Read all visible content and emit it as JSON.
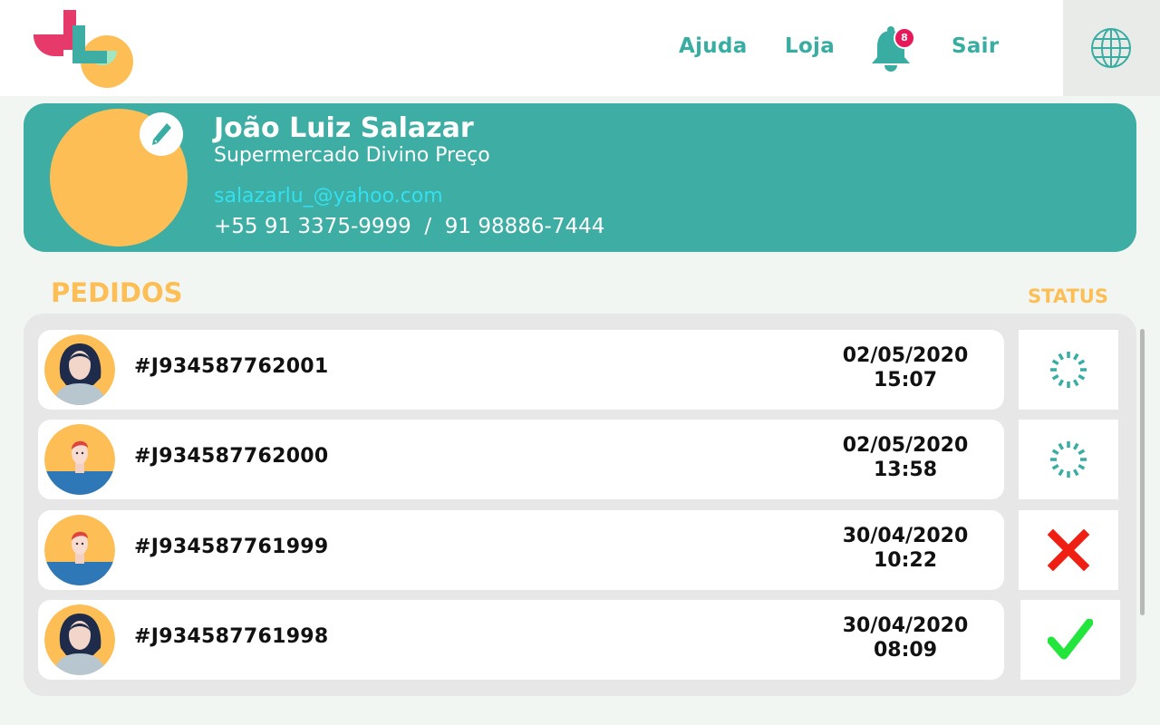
{
  "header": {
    "nav": {
      "help": "Ajuda",
      "store": "Loja",
      "logout": "Sair"
    },
    "notifications": {
      "count": "8",
      "icon": "bell-icon"
    },
    "language_icon": "globe-icon",
    "colors": {
      "accent": "#3aada3",
      "badge": "#e8195a"
    }
  },
  "profile": {
    "name": "João Luiz Salazar",
    "company": "Supermercado Divino Preço",
    "email": "salazarlu_@yahoo.com",
    "phones": "+55 91 3375-9999  /  91 98886-7444",
    "colors": {
      "card": "#3eada3",
      "avatar": "#fdbf55",
      "email": "#33e0f0"
    }
  },
  "orders": {
    "title": "PEDIDOS",
    "status_header": "STATUS",
    "items": [
      {
        "id": "#J934587762001",
        "date": "02/05/2020",
        "time": "15:07",
        "status": "loading",
        "status_icon": "loading-spinner-icon",
        "avatar": "woman-avatar"
      },
      {
        "id": "#J934587762000",
        "date": "02/05/2020",
        "time": "13:58",
        "status": "loading",
        "status_icon": "loading-spinner-icon",
        "avatar": "man-avatar"
      },
      {
        "id": "#J934587761999",
        "date": "30/04/2020",
        "time": "10:22",
        "status": "cancelled",
        "status_icon": "x-mark-icon",
        "avatar": "man-avatar"
      },
      {
        "id": "#J934587761998",
        "date": "30/04/2020",
        "time": "08:09",
        "status": "delivered",
        "status_icon": "check-mark-icon",
        "avatar": "woman-avatar"
      }
    ],
    "colors": {
      "title": "#fdbf55",
      "cancelled": "#f01f14",
      "delivered": "#22e63c",
      "loading": "#3aada3"
    }
  }
}
